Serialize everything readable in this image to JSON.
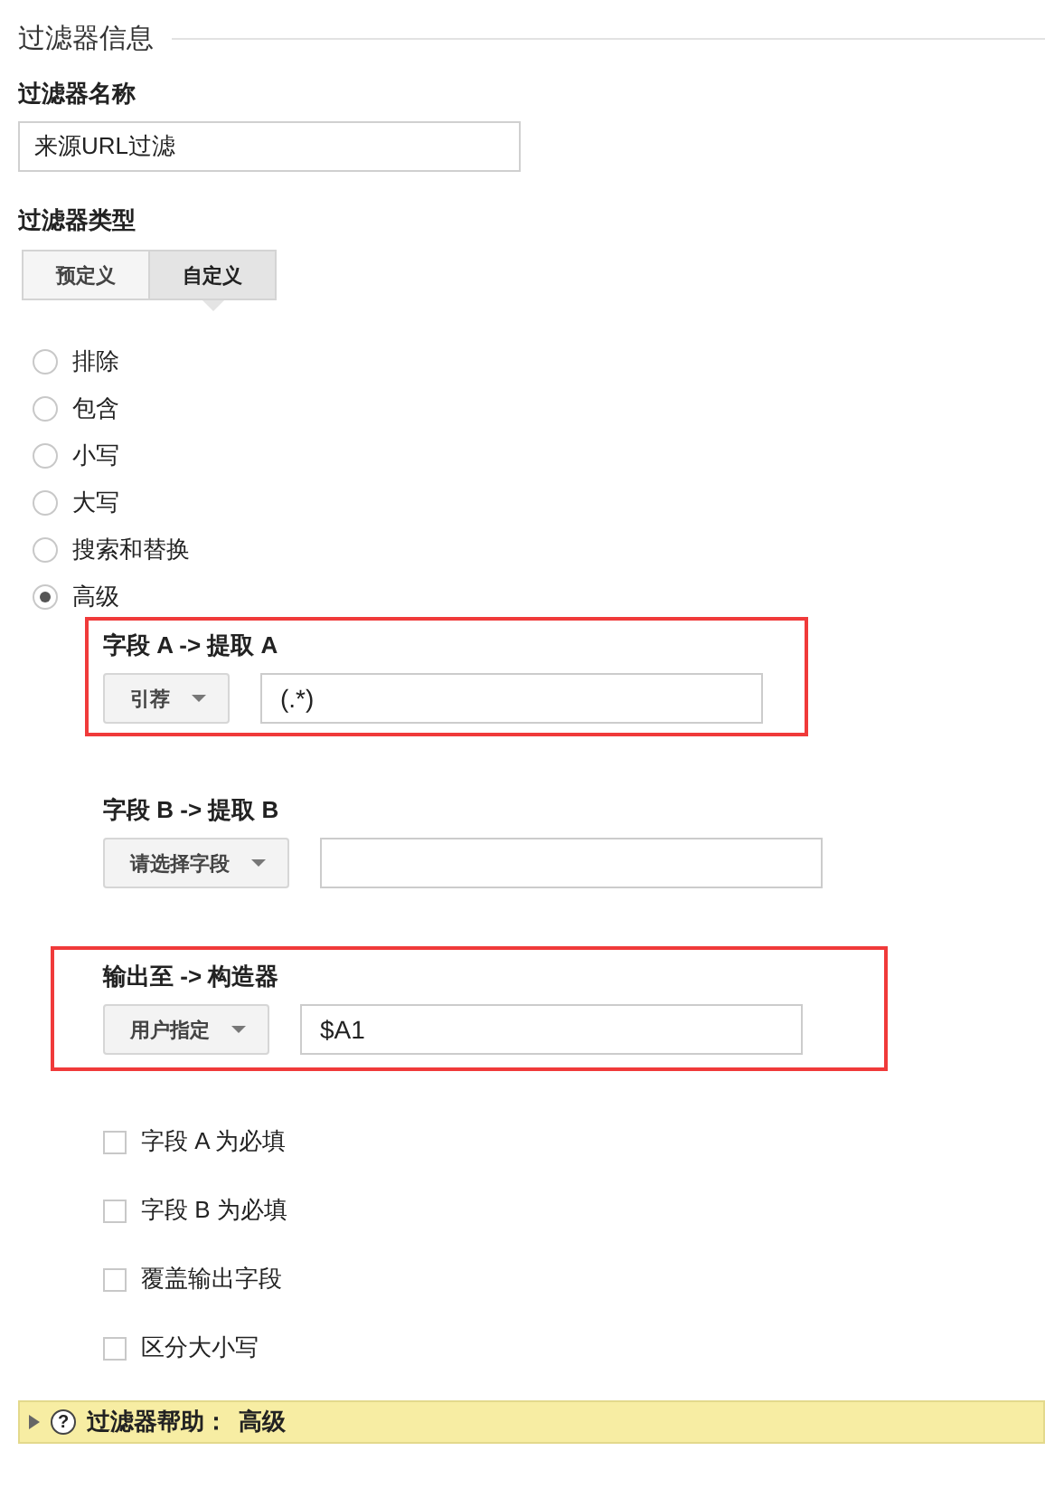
{
  "section_title": "过滤器信息",
  "filter_name": {
    "label": "过滤器名称",
    "value": "来源URL过滤"
  },
  "filter_type": {
    "label": "过滤器类型",
    "tabs": [
      {
        "label": "预定义",
        "selected": false
      },
      {
        "label": "自定义",
        "selected": true
      }
    ]
  },
  "options": [
    {
      "label": "排除",
      "selected": false
    },
    {
      "label": "包含",
      "selected": false
    },
    {
      "label": "小写",
      "selected": false
    },
    {
      "label": "大写",
      "selected": false
    },
    {
      "label": "搜索和替换",
      "selected": false
    },
    {
      "label": "高级",
      "selected": true
    }
  ],
  "field_groups": [
    {
      "label": "字段 A -> 提取 A",
      "dropdown": "引荐",
      "value": "(.*)",
      "highlighted": true
    },
    {
      "label": "字段 B -> 提取 B",
      "dropdown": "请选择字段",
      "highlighted": false
    },
    {
      "label": "输出至 -> 构造器",
      "dropdown": "用户指定",
      "value": "$A1",
      "highlighted": true
    }
  ],
  "checkboxes": [
    {
      "label": "字段 A 为必填",
      "checked": false
    },
    {
      "label": "字段 B 为必填",
      "checked": false
    },
    {
      "label": "覆盖输出字段",
      "checked": false
    },
    {
      "label": "区分大小写",
      "checked": false
    }
  ],
  "help_bar": {
    "icon": "?",
    "label": "过滤器帮助：",
    "topic": "高级",
    "expanded": false
  }
}
